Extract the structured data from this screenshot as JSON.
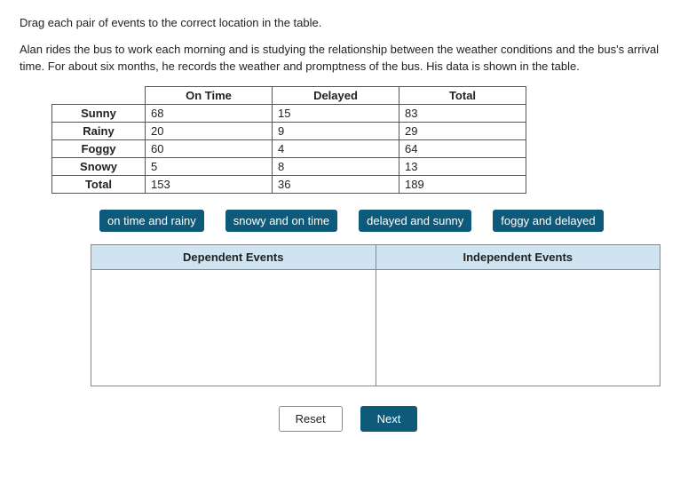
{
  "instruction": "Drag each pair of events to the correct location in the table.",
  "context": "Alan rides the bus to work each morning and is studying the relationship between the weather conditions and the bus's arrival time. For about six months, he records the weather and promptness of the bus. His data is shown in the table.",
  "table": {
    "columns": [
      "On Time",
      "Delayed",
      "Total"
    ],
    "rows": [
      {
        "label": "Sunny",
        "cells": [
          "68",
          "15",
          "83"
        ]
      },
      {
        "label": "Rainy",
        "cells": [
          "20",
          "9",
          "29"
        ]
      },
      {
        "label": "Foggy",
        "cells": [
          "60",
          "4",
          "64"
        ]
      },
      {
        "label": "Snowy",
        "cells": [
          "5",
          "8",
          "13"
        ]
      },
      {
        "label": "Total",
        "cells": [
          "153",
          "36",
          "189"
        ]
      }
    ]
  },
  "chips": [
    "on time and rainy",
    "snowy and on time",
    "delayed and sunny",
    "foggy and delayed"
  ],
  "drop": {
    "left_header": "Dependent Events",
    "right_header": "Independent Events"
  },
  "actions": {
    "reset": "Reset",
    "next": "Next"
  },
  "colors": {
    "chip_bg": "#0d5a7a",
    "drop_header_bg": "#cfe3f0"
  }
}
